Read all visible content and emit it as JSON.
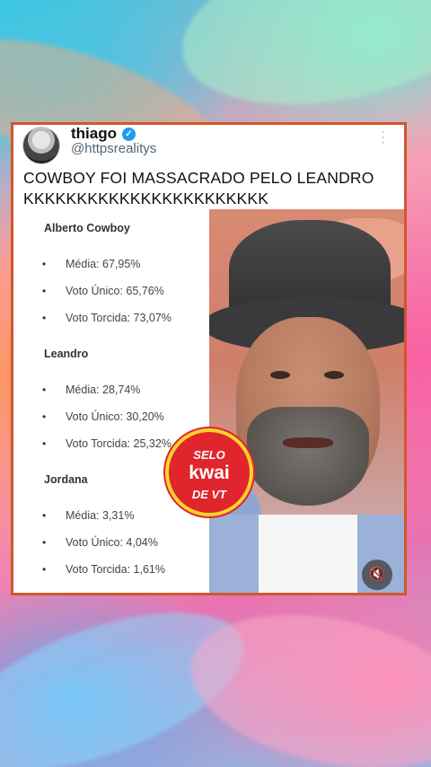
{
  "post": {
    "author_name": "thiago",
    "handle": "@httpsrealitys",
    "text": "COWBOY FOI MASSACRADO PELO LEANDRO KKKKKKKKKKKKKKKKKKKKKKK"
  },
  "results": [
    {
      "name": "Alberto Cowboy",
      "stats": [
        "Média: 67,95%",
        "Voto Único: 65,76%",
        "Voto Torcida: 73,07%"
      ]
    },
    {
      "name": "Leandro",
      "stats": [
        "Média: 28,74%",
        "Voto Único: 30,20%",
        "Voto Torcida: 25,32%"
      ]
    },
    {
      "name": "Jordana",
      "stats": [
        "Média: 3,31%",
        "Voto Único: 4,04%",
        "Voto Torcida: 1,61%"
      ]
    }
  ],
  "bullet": "•",
  "badge": {
    "line1": "SELO",
    "line2": "kwai",
    "line3": "DE VT"
  },
  "icons": {
    "verified": "verified-badge-icon",
    "more": "more-options-icon",
    "mute": "speaker-muted-icon"
  },
  "colors": {
    "card_border": "#d2572a",
    "verified": "#1d9bf0",
    "badge_fill": "#e0252d",
    "badge_ring": "#ffd42a"
  }
}
